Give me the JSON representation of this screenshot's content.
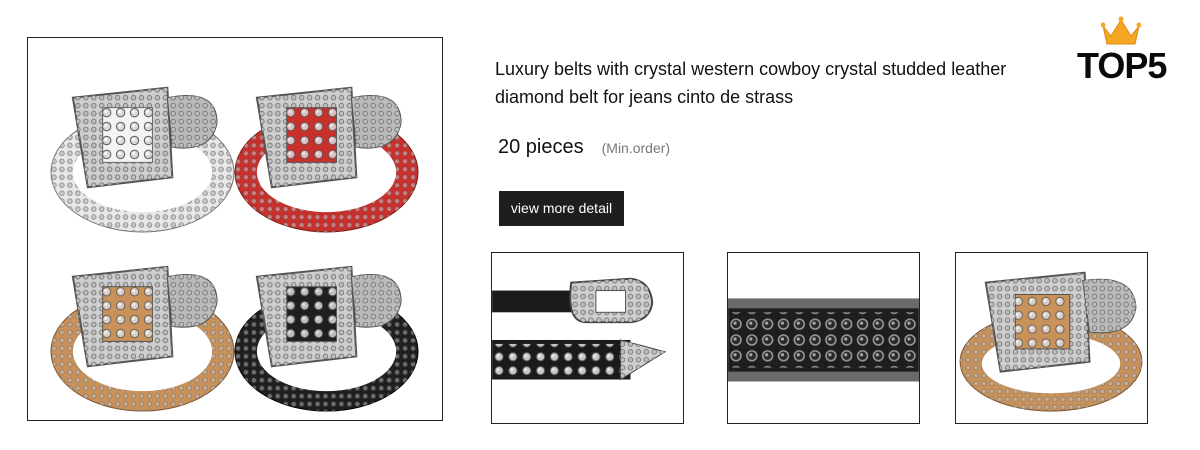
{
  "product": {
    "title": "Luxury belts with crystal western cowboy crystal studded leather diamond belt for jeans cinto de strass",
    "moq_value": "20 pieces",
    "moq_label": "(Min.order)",
    "detail_button": "view more detail"
  },
  "badge": {
    "text": "TOP5",
    "icon": "crown-icon",
    "crown_color": "#f5a623"
  },
  "images": {
    "main": "four rhinestone studded western belts (silver, red, tan, black)",
    "thumbnails": [
      "black belt with silver buckle",
      "close-up of studded black strap",
      "tan studded belt with buckle"
    ]
  },
  "colors": {
    "button_bg": "#1e1e1e",
    "belt_red": "#c9302c",
    "belt_tan": "#c9925a",
    "belt_black": "#1f1f1f",
    "belt_white": "#e8e8e8"
  }
}
